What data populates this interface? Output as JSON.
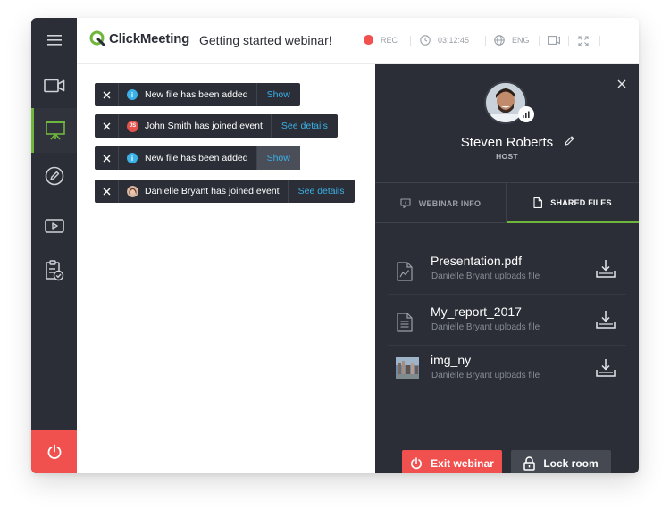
{
  "app": {
    "brand": "ClickMeeting",
    "event_title": "Getting started webinar!"
  },
  "topbar": {
    "rec_label": "REC",
    "timer": "03:12:45",
    "language": "ENG"
  },
  "notifications": [
    {
      "message": "New file has been added",
      "action": "Show",
      "icon": "info-icon"
    },
    {
      "message": "John Smith has joined event",
      "action": "See details",
      "initials": "JS"
    },
    {
      "message": "New file has been added",
      "action": "Show",
      "icon": "info-icon"
    },
    {
      "message": "Danielle Bryant has joined event",
      "action": "See details",
      "icon": "avatar"
    }
  ],
  "panel": {
    "host_name": "Steven Roberts",
    "host_role": "HOST",
    "tabs": [
      {
        "label": "WEBINAR INFO"
      },
      {
        "label": "SHARED FILES"
      }
    ],
    "files": [
      {
        "name": "Presentation.pdf",
        "subtitle": "Danielle Bryant uploads file",
        "icon": "chart-file-icon"
      },
      {
        "name": "My_report_2017",
        "subtitle": "Danielle Bryant uploads file",
        "icon": "document-file-icon"
      },
      {
        "name": "img_ny",
        "subtitle": "Danielle Bryant uploads file",
        "icon": "image-thumbnail"
      }
    ],
    "exit_label": "Exit webinar",
    "lock_label": "Lock room"
  },
  "colors": {
    "dark": "#2b2e36",
    "accent_green": "#6fb73c",
    "link_blue": "#3ab1e9",
    "danger_red": "#f0514f"
  }
}
